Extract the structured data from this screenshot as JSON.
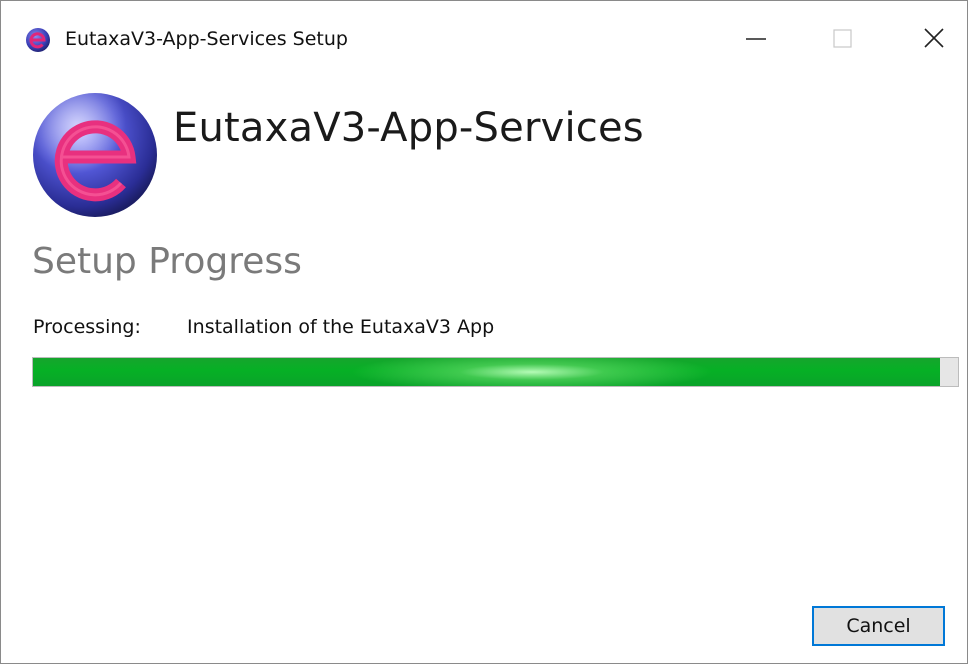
{
  "window": {
    "title": "EutaxaV3-App-Services Setup",
    "icon": "eutaxa-logo-icon",
    "controls": {
      "minimize": "minimize-icon",
      "maximize": "maximize-icon",
      "close": "close-icon"
    }
  },
  "header": {
    "app_name": "EutaxaV3-App-Services",
    "logo": "eutaxa-logo"
  },
  "progress": {
    "section_title": "Setup Progress",
    "status_label": "Processing:",
    "status_value": "Installation of the EutaxaV3 App",
    "fraction": 0.98,
    "bar_color": "#06b025"
  },
  "buttons": {
    "cancel_label": "Cancel"
  },
  "colors": {
    "accent": "#0078d7",
    "logo_ring": "#3a3fb5",
    "logo_letter": "#e0267a"
  }
}
